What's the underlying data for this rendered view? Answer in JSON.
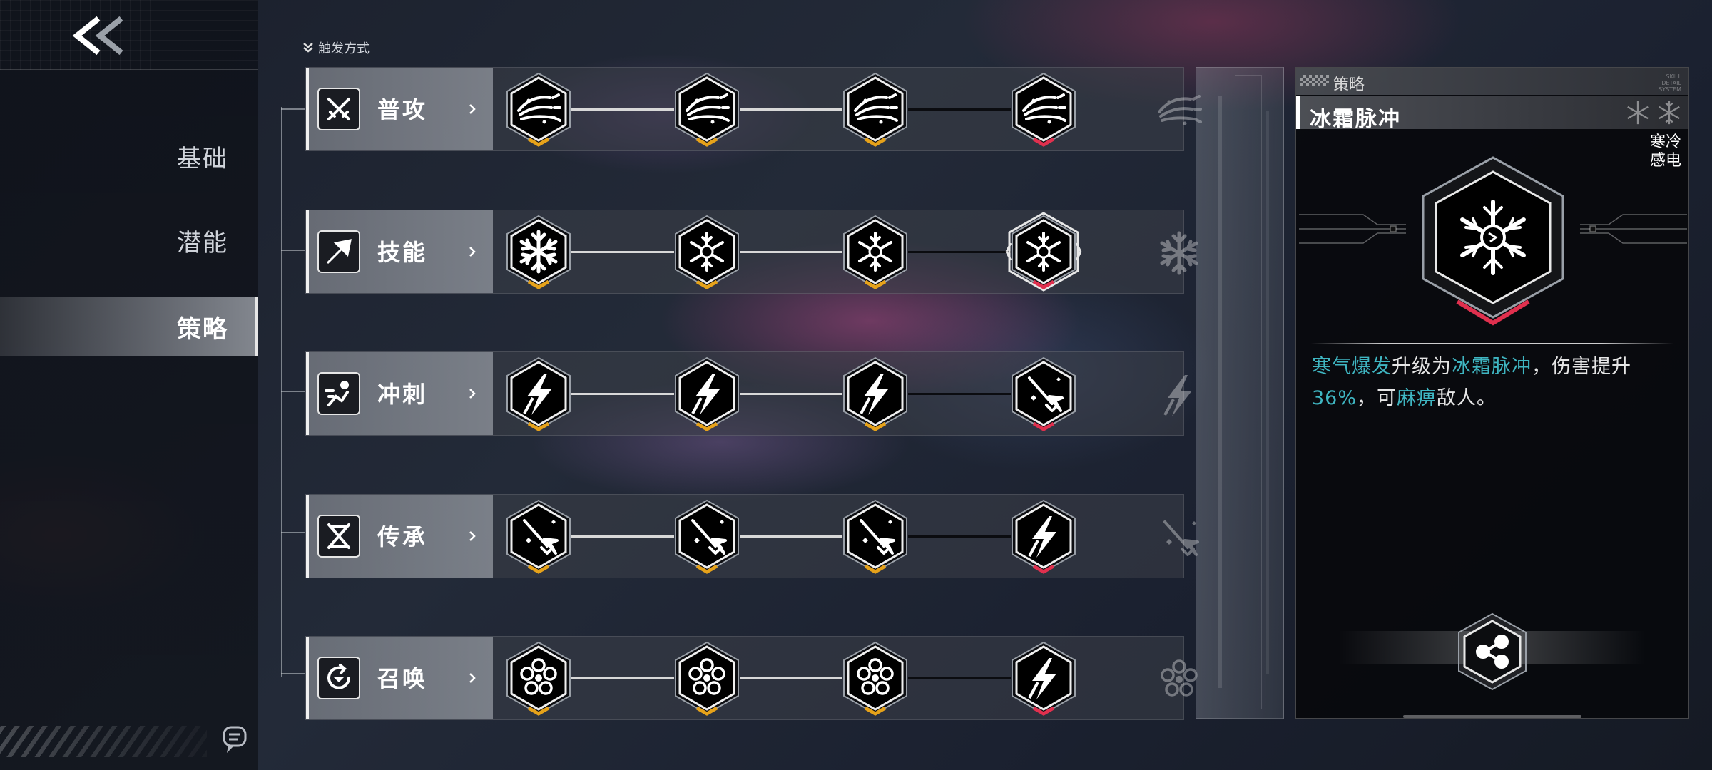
{
  "sidebar": {
    "back_label": "<<",
    "nav": [
      {
        "label": "基础",
        "active": false
      },
      {
        "label": "潜能",
        "active": false
      },
      {
        "label": "策略",
        "active": true
      }
    ]
  },
  "trigger": {
    "label": "触发方式"
  },
  "rows": [
    {
      "label": "普攻",
      "icon": "cross-swords-icon",
      "nodes": [
        {
          "icon": "slash-wave-icon",
          "state": "upgraded"
        },
        {
          "icon": "slash-wave-icon",
          "state": "upgraded"
        },
        {
          "icon": "slash-wave-icon",
          "state": "upgraded"
        },
        {
          "icon": "slash-wave-icon",
          "state": "active"
        }
      ]
    },
    {
      "label": "技能",
      "icon": "arrow-up-right-icon",
      "nodes": [
        {
          "icon": "snowflake-icon",
          "state": "upgraded"
        },
        {
          "icon": "ice-burst-icon",
          "state": "upgraded"
        },
        {
          "icon": "ice-burst-icon",
          "state": "upgraded"
        },
        {
          "icon": "frost-pulse-icon",
          "state": "selected"
        }
      ]
    },
    {
      "label": "冲刺",
      "icon": "dash-runner-icon",
      "nodes": [
        {
          "icon": "lightning-bolt-icon",
          "state": "upgraded"
        },
        {
          "icon": "lightning-bolt-icon",
          "state": "upgraded"
        },
        {
          "icon": "lightning-bolt-icon",
          "state": "upgraded"
        },
        {
          "icon": "spear-icon",
          "state": "active"
        }
      ]
    },
    {
      "label": "传承",
      "icon": "dna-icon",
      "nodes": [
        {
          "icon": "spear-icon",
          "state": "upgraded"
        },
        {
          "icon": "spear-icon",
          "state": "upgraded"
        },
        {
          "icon": "spear-icon",
          "state": "upgraded"
        },
        {
          "icon": "lightning-bolt-icon",
          "state": "active"
        }
      ]
    },
    {
      "label": "召唤",
      "icon": "summon-cycle-icon",
      "nodes": [
        {
          "icon": "flower-orb-icon",
          "state": "upgraded"
        },
        {
          "icon": "flower-orb-icon",
          "state": "upgraded"
        },
        {
          "icon": "flower-orb-icon",
          "state": "upgraded"
        },
        {
          "icon": "lightning-bolt-icon",
          "state": "active"
        }
      ]
    }
  ],
  "detail": {
    "tag": "策略",
    "tiny_text": "SKILL\nDETAIL\nSYSTEM",
    "title": "冰霜脉冲",
    "elements": [
      "寒冷",
      "感电"
    ],
    "desc_kw1": "寒气爆发",
    "desc_t1": "升级为",
    "desc_kw2": "冰霜脉冲",
    "desc_t2": "，伤害提升",
    "desc_kw3": "36%",
    "desc_t3": "，可",
    "desc_kw4": "麻痹",
    "desc_t4": "敌人。"
  },
  "colors": {
    "accent_cyan": "#3fb6c2",
    "upgrade_gold": "#e6a21a",
    "active_red": "#e0304e"
  }
}
